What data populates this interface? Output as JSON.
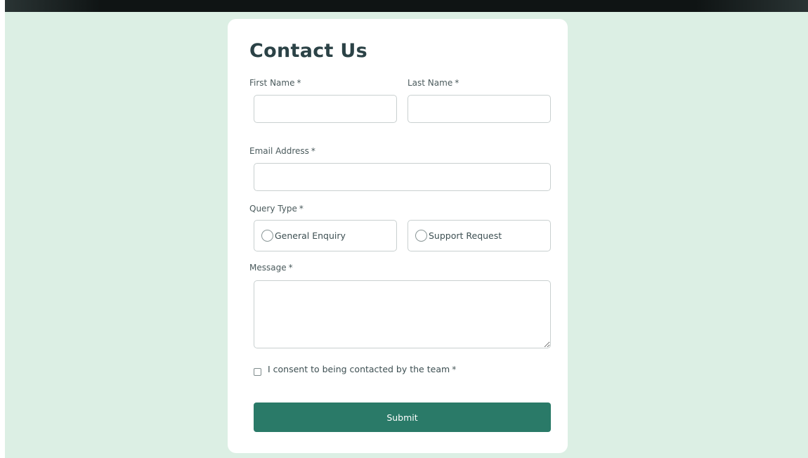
{
  "form": {
    "title": "Contact Us",
    "required_marker": "*",
    "first_name": {
      "label": "First Name",
      "value": ""
    },
    "last_name": {
      "label": "Last Name",
      "value": ""
    },
    "email": {
      "label": "Email Address",
      "value": ""
    },
    "query_type": {
      "label": "Query Type",
      "options": [
        "General Enquiry",
        "Support Request"
      ],
      "selected": null
    },
    "message": {
      "label": "Message",
      "value": ""
    },
    "consent": {
      "label": "I consent to being contacted by the team",
      "checked": false
    },
    "submit_label": "Submit"
  },
  "colors": {
    "page_background": "#dcefe4",
    "card_background": "#ffffff",
    "accent": "#2a7a68",
    "heading_text": "#2b4246",
    "top_bar": "#0f1414"
  }
}
